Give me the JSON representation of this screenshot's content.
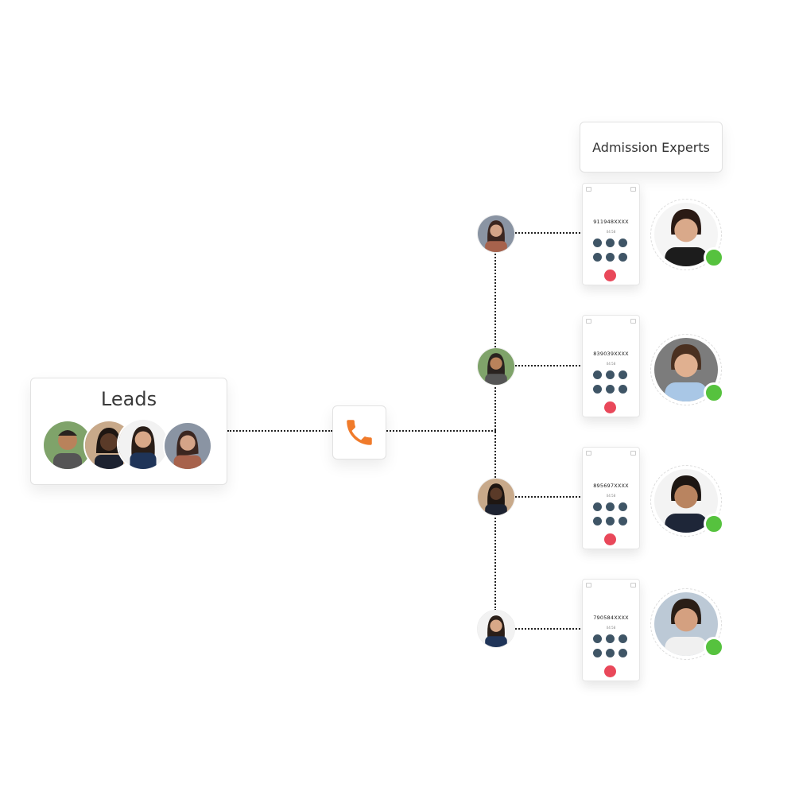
{
  "leads_card": {
    "title": "Leads",
    "avatars": [
      "lead-man-glasses",
      "lead-woman-smiling",
      "lead-woman-blazer",
      "lead-woman-casual"
    ]
  },
  "center_node": {
    "icon": "phone-icon",
    "accent": "#f07b2b"
  },
  "experts_label": "Admission Experts",
  "calls": [
    {
      "lead": "lead-woman-casual",
      "number": "911948XXXX",
      "timer": "04:58",
      "expert": "expert-woman-curly-hair",
      "status": "online"
    },
    {
      "lead": "lead-man-glasses",
      "number": "839039XXXX",
      "timer": "04:58",
      "expert": "expert-man-smiling",
      "status": "online"
    },
    {
      "lead": "lead-woman-smiling",
      "number": "895697XXXX",
      "timer": "04:58",
      "expert": "expert-man-suit",
      "status": "online"
    },
    {
      "lead": "lead-woman-blazer",
      "number": "790584XXXX",
      "timer": "04:58",
      "expert": "expert-man-beard",
      "status": "online"
    }
  ],
  "colors": {
    "status_online": "#56c23e",
    "end_call": "#e9485a",
    "dialer_button": "#3f5566"
  }
}
